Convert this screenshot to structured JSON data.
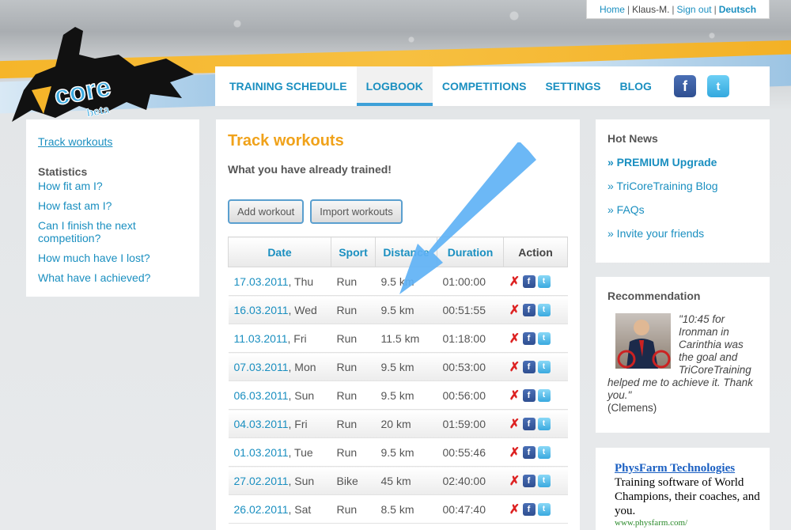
{
  "toplinks": {
    "home": "Home",
    "user": "Klaus-M.",
    "signout": "Sign out",
    "lang": "Deutsch",
    "sep": "|"
  },
  "nav": [
    {
      "label": "TRAINING SCHEDULE"
    },
    {
      "label": "LOGBOOK"
    },
    {
      "label": "COMPETITIONS"
    },
    {
      "label": "SETTINGS"
    },
    {
      "label": "BLOG"
    }
  ],
  "logo": {
    "text": "core",
    "sub": "beta"
  },
  "sidebar": {
    "track": "Track workouts",
    "stats_heading": "Statistics",
    "items": [
      {
        "label": "How fit am I?"
      },
      {
        "label": "How fast am I?"
      },
      {
        "label": "Can I finish the next competition?"
      },
      {
        "label": "How much have I lost?"
      },
      {
        "label": "What have I achieved?"
      }
    ]
  },
  "main": {
    "title": "Track workouts",
    "subtitle": "What you have already trained!",
    "add_btn": "Add workout",
    "import_btn": "Import workouts",
    "columns": [
      "Date",
      "Sport",
      "Distance",
      "Duration",
      "Action"
    ],
    "rows": [
      {
        "date": "17.03.2011",
        "day": ", Thu",
        "sport": "Run",
        "distance": "9.5 km",
        "duration": "01:00:00"
      },
      {
        "date": "16.03.2011",
        "day": ", Wed",
        "sport": "Run",
        "distance": "9.5 km",
        "duration": "00:51:55"
      },
      {
        "date": "11.03.2011",
        "day": ", Fri",
        "sport": "Run",
        "distance": "11.5 km",
        "duration": "01:18:00"
      },
      {
        "date": "07.03.2011",
        "day": ", Mon",
        "sport": "Run",
        "distance": "9.5 km",
        "duration": "00:53:00"
      },
      {
        "date": "06.03.2011",
        "day": ", Sun",
        "sport": "Run",
        "distance": "9.5 km",
        "duration": "00:56:00"
      },
      {
        "date": "04.03.2011",
        "day": ", Fri",
        "sport": "Run",
        "distance": "20 km",
        "duration": "01:59:00"
      },
      {
        "date": "01.03.2011",
        "day": ", Tue",
        "sport": "Run",
        "distance": "9.5 km",
        "duration": "00:55:46"
      },
      {
        "date": "27.02.2011",
        "day": ", Sun",
        "sport": "Bike",
        "distance": "45 km",
        "duration": "02:40:00"
      },
      {
        "date": "26.02.2011",
        "day": ", Sat",
        "sport": "Run",
        "distance": "8.5 km",
        "duration": "00:47:40"
      }
    ]
  },
  "hotnews": {
    "title": "Hot News",
    "items": [
      "» PREMIUM Upgrade",
      "» TriCoreTraining Blog",
      "» FAQs",
      "» Invite your friends"
    ]
  },
  "recommendation": {
    "title": "Recommendation",
    "quote": "\"10:45 for Ironman in Carinthia was the goal and TriCoreTraining helped me to achieve it. Thank you.\"",
    "by": "(Clemens)"
  },
  "ad": {
    "title": "PhysFarm Technologies",
    "text": "Training software of World Champions, their coaches, and you.",
    "url": "www.physfarm.com/"
  },
  "colors": {
    "accent": "#1a8fc0",
    "title": "#f0a21a",
    "arrow": "#5fb2f5"
  }
}
